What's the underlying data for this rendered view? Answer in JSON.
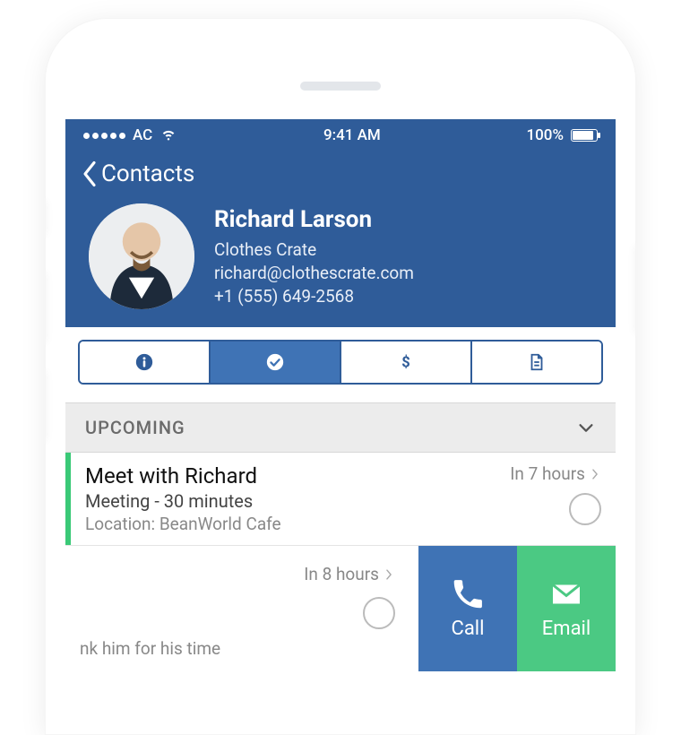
{
  "status": {
    "carrier": "AC",
    "time": "9:41 AM",
    "battery_pct": "100%"
  },
  "header": {
    "back_label": "Contacts",
    "name": "Richard Larson",
    "company": "Clothes Crate",
    "email": "richard@clothescrate.com",
    "phone": "+1 (555) 649-2568"
  },
  "tabs": {
    "info_icon": "info-icon",
    "activity_icon": "checkmark-circle-icon",
    "deals_icon": "dollar-icon",
    "notes_icon": "document-icon"
  },
  "section": {
    "upcoming_label": "UPCOMING"
  },
  "event1": {
    "title": "Meet with Richard",
    "subtitle": "Meeting - 30 minutes",
    "location": "Location: BeanWorld Cafe",
    "due": "In 7 hours"
  },
  "event2": {
    "due": "In 8 hours",
    "partial_text": "nk him for his time"
  },
  "actions": {
    "call_label": "Call",
    "email_label": "Email"
  }
}
